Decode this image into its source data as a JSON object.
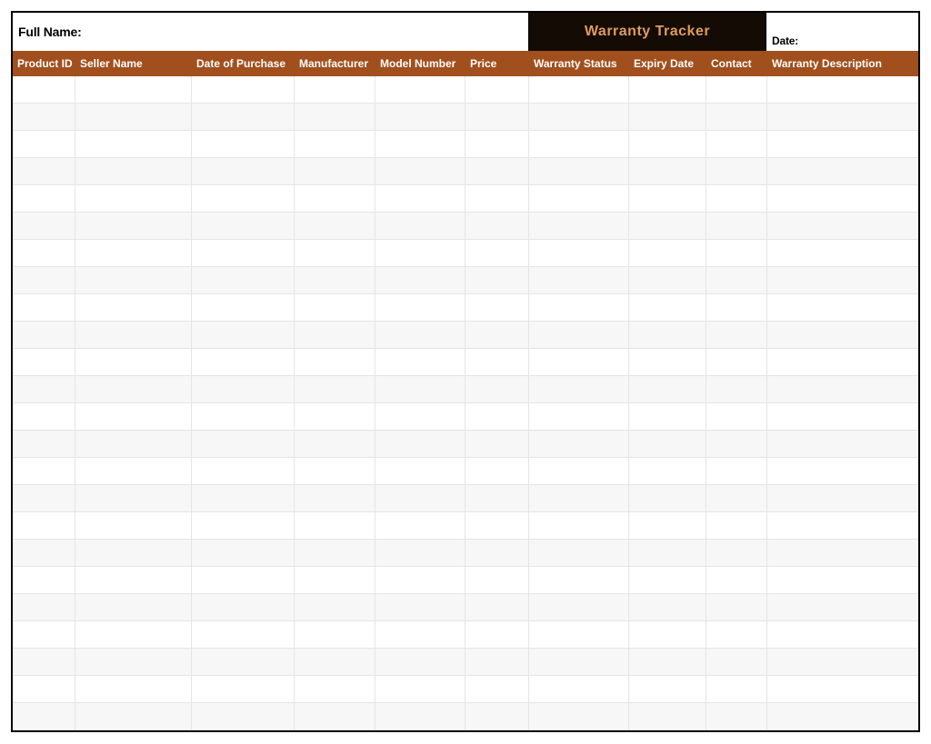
{
  "header": {
    "full_name_label": "Full Name:",
    "title": "Warranty Tracker",
    "date_label": "Date:"
  },
  "columns": [
    "Product ID",
    "Seller Name",
    "Date of Purchase",
    "Manufacturer",
    "Model Number",
    "Price",
    "Warranty Status",
    "Expiry Date",
    "Contact",
    "Warranty Description"
  ],
  "row_count": 24
}
